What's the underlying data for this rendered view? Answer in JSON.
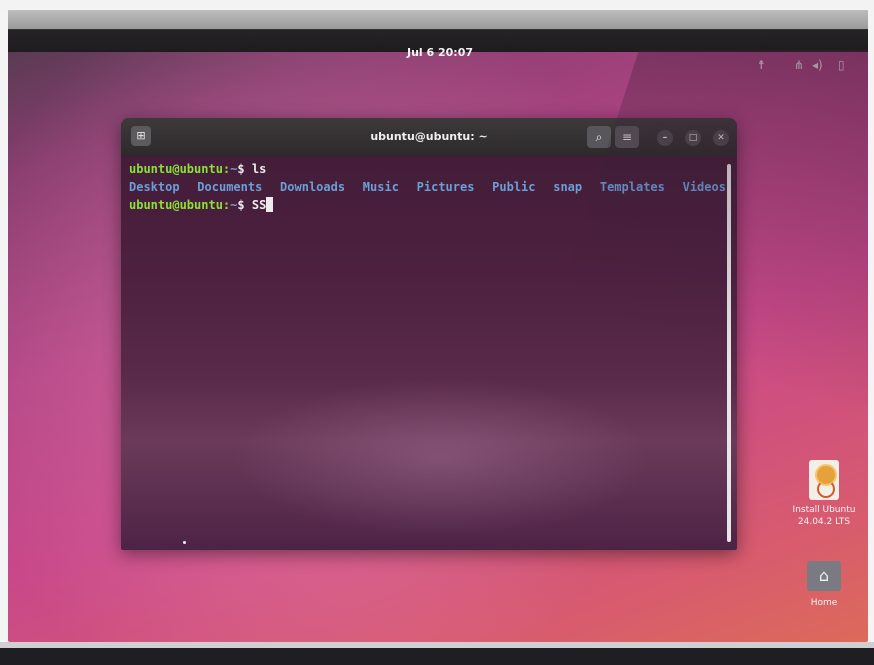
{
  "topbar": {
    "clock": "Jul 6  20:07",
    "tray_icons": [
      "accessibility-icon",
      "network-icon",
      "volume-icon",
      "battery-icon"
    ]
  },
  "terminal": {
    "title": "ubuntu@ubuntu: ~",
    "header_buttons": [
      "search-icon",
      "menu-icon"
    ],
    "window_controls": [
      "minimize-icon",
      "maximize-icon",
      "close-icon"
    ],
    "lines": [
      {
        "user": "ubuntu@ubuntu:",
        "path": "~",
        "symbol": "$",
        "command": "ls"
      },
      {
        "user": "ubuntu@ubuntu:",
        "path": "~",
        "symbol": "$",
        "command": "SS"
      }
    ],
    "ls_output": [
      "Desktop",
      "Documents",
      "Downloads",
      "Music",
      "Pictures",
      "Public",
      "snap",
      "Templates",
      "Videos"
    ]
  },
  "desktop": {
    "install_ubuntu": {
      "line1": "Install Ubuntu",
      "line2": "24.04.2 LTS"
    },
    "home": {
      "label": "Home"
    }
  },
  "colors": {
    "prompt_user": "#8ae234",
    "directory": "#6a9fd8",
    "terminal_bg": "#4d2040",
    "wallpaper_accent": "#c8488a"
  }
}
